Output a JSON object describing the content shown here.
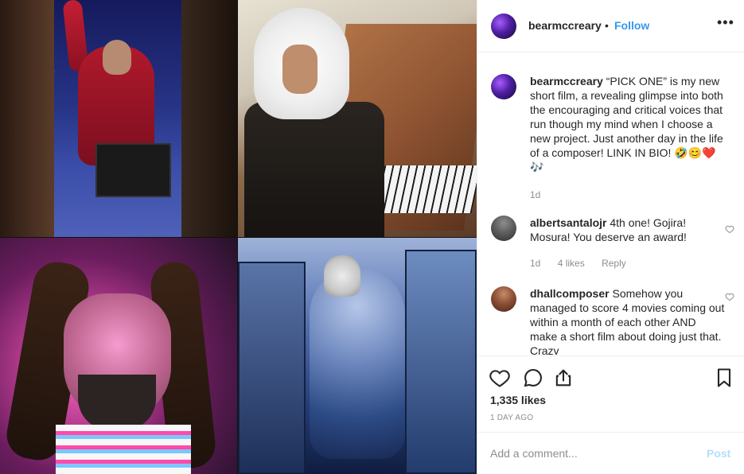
{
  "post": {
    "author": "bearmccreary",
    "separator": "•",
    "follow_label": "Follow",
    "more_icon": "more-icon"
  },
  "comments": [
    {
      "username": "bearmccreary",
      "text": "“PICK ONE” is my new short film, a revealing glimpse into both the encouraging and critical voices that run though my mind when I choose a new project. Just another day in the life of a composer! LINK IN BIO! 🤣😊❤️🎶",
      "age": "1d"
    },
    {
      "username": "albertsantalojr",
      "text": "4th one! Gojira! Mosura! You deserve an award!",
      "age": "1d",
      "likes": "4 likes",
      "reply": "Reply"
    },
    {
      "username": "dhallcomposer",
      "text": "Somehow you managed to score 4 movies coming out within a month of each other AND make a short film about doing just that. Crazy"
    }
  ],
  "actions": {
    "like_icon": "heart-icon",
    "comment_icon": "comment-icon",
    "share_icon": "share-icon",
    "save_icon": "bookmark-icon"
  },
  "likes": "1,335 likes",
  "posted": "1 DAY AGO",
  "add_comment": {
    "placeholder": "Add a comment...",
    "post_label": "Post"
  }
}
